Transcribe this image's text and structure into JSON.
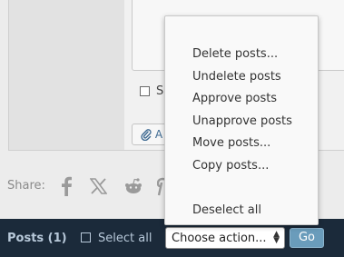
{
  "background": {
    "checkbox_label": "S",
    "attach_label": "A"
  },
  "share": {
    "label": "Share:",
    "icons": [
      "facebook-icon",
      "x-icon",
      "reddit-icon",
      "pinterest-icon"
    ]
  },
  "bottom_bar": {
    "posts_label": "Posts (1)",
    "select_all_label": "Select all",
    "action_select_value": "Choose action...",
    "go_label": "Go"
  },
  "menu": {
    "items": [
      "Delete posts...",
      "Undelete posts",
      "Approve posts",
      "Unapprove posts",
      "Move posts...",
      "Copy posts...",
      "Deselect all"
    ]
  },
  "colors": {
    "bottom_bar": "#1b2a3a",
    "go_button": "#6a9cbb",
    "link": "#3e6a92"
  }
}
